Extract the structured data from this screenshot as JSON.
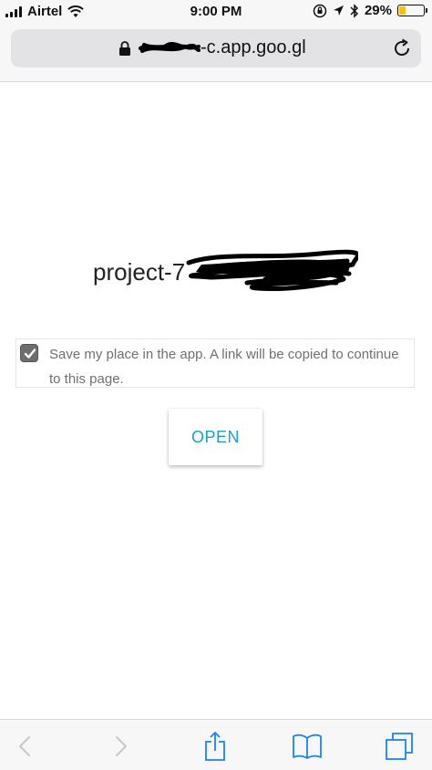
{
  "status_bar": {
    "carrier": "Airtel",
    "time": "9:00 PM",
    "battery_percent": "29%",
    "battery_level": 0.29,
    "icons": [
      "signal-icon",
      "wifi-icon",
      "orientation-lock-icon",
      "location-icon",
      "bluetooth-icon",
      "battery-icon"
    ]
  },
  "browser": {
    "url": "c.app.goo.gl",
    "url_visible_fragment": "-c.app.goo.gl",
    "icons": [
      "lock-icon",
      "reload-icon"
    ]
  },
  "page": {
    "project_prefix": "project-7",
    "save_text": "Save my place in the app. A link will be copied to continue to this page.",
    "save_checked": true,
    "open_label": "OPEN"
  },
  "toolbar": {
    "icons": [
      "back-icon",
      "forward-icon",
      "share-icon",
      "bookmarks-icon",
      "tabs-icon"
    ]
  },
  "colors": {
    "accent": "#1aa0cc",
    "ios_blue": "#1a82fb",
    "battery_fill": "#f4c20d",
    "disabled_gray": "#c7c7cc"
  }
}
